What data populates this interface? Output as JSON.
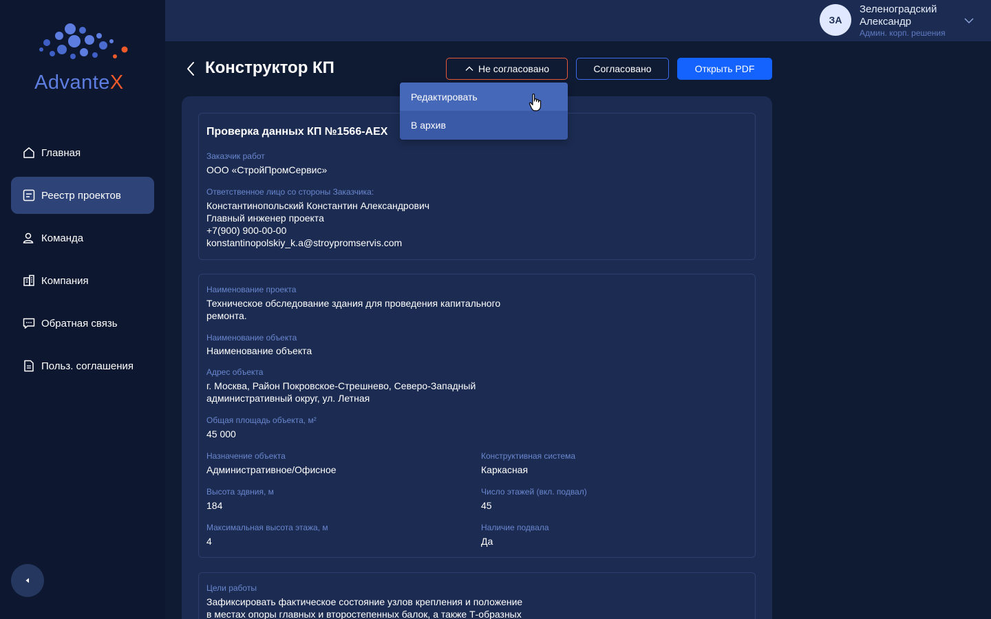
{
  "brand": {
    "logo_text_main": "Advante",
    "logo_text_accent": "X",
    "accent_color": "#ef5a2a",
    "primary_color": "#1463ff"
  },
  "sidebar": {
    "items": [
      {
        "label": "Главная",
        "icon": "home-icon",
        "active": false
      },
      {
        "label": "Реестр проектов",
        "icon": "projects-registry-icon",
        "active": true
      },
      {
        "label": "Команда",
        "icon": "team-icon",
        "active": false
      },
      {
        "label": "Компания",
        "icon": "company-building-icon",
        "active": false
      },
      {
        "label": "Обратная связь",
        "icon": "feedback-chat-icon",
        "active": false
      },
      {
        "label": "Польз. соглашения",
        "icon": "document-icon",
        "active": false
      }
    ],
    "collapse_icon": "collapse-arrow-icon"
  },
  "user": {
    "initials": "ЗА",
    "name": "Зеленоградский Александр",
    "role": "Админ. корп. решения"
  },
  "header": {
    "title": "Конструктор КП",
    "status_button": "Не согласовано",
    "agreed_button": "Согласовано",
    "pdf_button": "Открыть PDF"
  },
  "dropdown": {
    "items": [
      "Редактировать",
      "В архив"
    ]
  },
  "card1": {
    "title": "Проверка данных КП №1566-AEX",
    "customer_label": "Заказчик работ",
    "customer_value": "ООО «СтройПромСервис»",
    "contact_label": "Ответственное лицо со стороны Заказчика:",
    "contact_name": "Константинопольский Константин Александрович",
    "contact_position": "Главный инженер проекта",
    "contact_phone": "+7(900) 900-00-00",
    "contact_email": "konstantinopolskiy_k.a@stroypromservis.com"
  },
  "card2": {
    "project_name_label": "Наименование проекта",
    "project_name_line1": "Техническое обследование здания для проведения капитального",
    "project_name_line2": "ремонта.",
    "object_name_label": "Наименование объекта",
    "object_name_value": "Наименование объекта",
    "address_label": "Адрес объекта",
    "address_line1": "г. Москва, Район Покровское-Стрешнево, Северо-Западный",
    "address_line2": "административный округ, ул. Летная",
    "area_label": "Общая площадь объекта, м²",
    "area_value": "45 000",
    "purpose_label": "Назначение объекта",
    "purpose_value": "Административное/Офисное",
    "structure_label": "Конструктивная система",
    "structure_value": "Каркасная",
    "height_label": "Высота здвния, м",
    "height_value": "184",
    "floors_label": "Число этажей (вкл. подвал)",
    "floors_value": "45",
    "max_floor_height_label": "Максимальная высота этажа, м",
    "max_floor_height_value": "4",
    "basement_label": "Наличие подвала",
    "basement_value": "Да"
  },
  "card3": {
    "goals_label": "Цели работы",
    "goals_line1": "Зафиксировать фактическое состояние узлов крепления и положение",
    "goals_line2": "в местах опоры главных и второстепенных балок, а также Т-образных"
  }
}
